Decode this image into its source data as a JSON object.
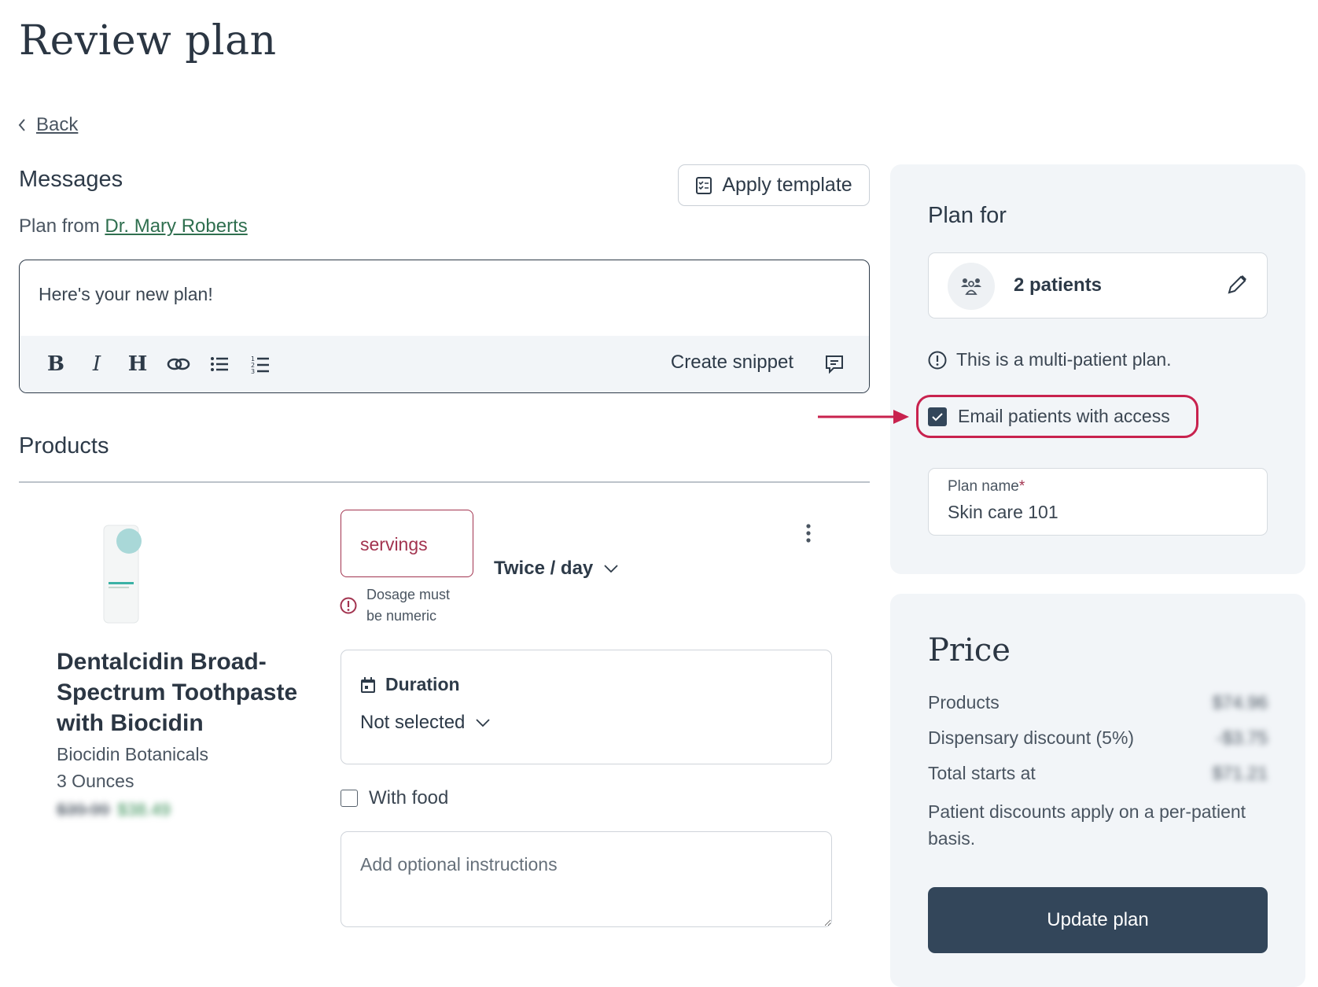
{
  "page": {
    "title": "Review plan",
    "back_label": "Back"
  },
  "messages": {
    "heading": "Messages",
    "apply_template_label": "Apply template",
    "plan_from_prefix": "Plan from ",
    "doctor_name": "Dr. Mary Roberts",
    "message_text": "Here's your new plan!",
    "toolbar": {
      "bold": "B",
      "italic": "I",
      "heading": "H",
      "create_snippet_label": "Create snippet"
    }
  },
  "products": {
    "heading": "Products",
    "items": [
      {
        "name": "Dentalcidin Broad-Spectrum Toothpaste with Biocidin",
        "brand": "Biocidin Botanicals",
        "size": "3 Ounces",
        "price_original": "$39.99",
        "price_discounted": "$38.49",
        "dosage_value": "servings",
        "dosage_error": "Dosage must be numeric",
        "frequency": "Twice / day",
        "duration_label": "Duration",
        "duration_value": "Not selected",
        "with_food_label": "With food",
        "with_food_checked": false,
        "instructions_placeholder": "Add optional instructions"
      }
    ]
  },
  "plan_for": {
    "heading": "Plan for",
    "patients_label": "2 patients",
    "multi_patient_note": "This is a multi-patient plan.",
    "email_label": "Email patients with access",
    "email_checked": true,
    "plan_name_label": "Plan name",
    "plan_name_required": "*",
    "plan_name_value": "Skin care 101"
  },
  "price": {
    "heading": "Price",
    "rows": [
      {
        "label": "Products",
        "amount": "$74.96"
      },
      {
        "label": "Dispensary discount (5%)",
        "amount": "-$3.75"
      },
      {
        "label": "Total starts at",
        "amount": "$71.21"
      }
    ],
    "note": "Patient discounts apply on a per-patient basis.",
    "update_button_label": "Update plan"
  },
  "colors": {
    "text_primary": "#2d3a48",
    "link_green": "#2f6f4f",
    "error": "#a2334f",
    "highlight": "#c8224e",
    "panel_bg": "#f2f5f8",
    "button_dark": "#33465a"
  }
}
